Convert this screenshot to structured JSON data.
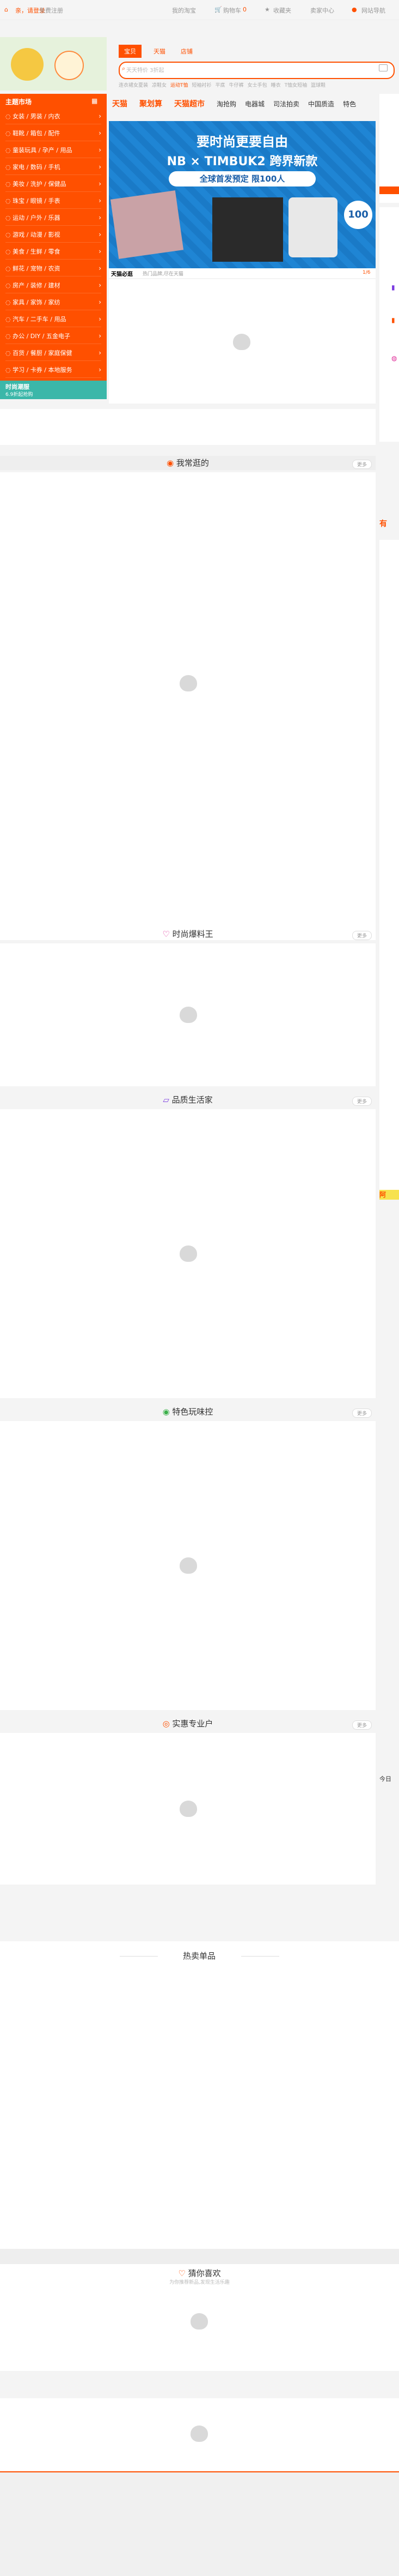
{
  "topbar": {
    "greeting": "亲，请登录",
    "register": "免费注册",
    "my_taobao": "我的淘宝",
    "cart": "购物车",
    "cart_count": "0",
    "favorites": "收藏夹",
    "seller_center": "卖家中心",
    "site_nav": "网站导航"
  },
  "search": {
    "tabs": [
      "宝贝",
      "天猫",
      "店铺"
    ],
    "placeholder": "天天特价 3折起",
    "hotwords": [
      "连衣裙女夏装",
      "凉鞋女",
      "运动T恤",
      "短袖衬衫",
      "平底",
      "牛仔裤",
      "女士手包",
      "睡衣",
      "T恤女短袖",
      "篮球鞋"
    ]
  },
  "nav": {
    "items": [
      "天猫",
      "聚划算",
      "天猫超市",
      "淘抢购",
      "电器城",
      "司法拍卖",
      "中国质造",
      "特色"
    ]
  },
  "sidebar": {
    "title": "主题市场",
    "categories": [
      "女装 / 男装 / 内衣",
      "鞋靴 / 箱包 / 配件",
      "童装玩具 / 孕产 / 用品",
      "家电 / 数码 / 手机",
      "美妆 / 洗护 / 保健品",
      "珠宝 / 眼镜 / 手表",
      "运动 / 户外 / 乐器",
      "游戏 / 动漫 / 影视",
      "美食 / 生鲜 / 零食",
      "鲜花 / 宠物 / 农资",
      "房产 / 装修 / 建材",
      "家具 / 家饰 / 家纺",
      "汽车 / 二手车 / 用品",
      "办公 / DIY / 五金电子",
      "百货 / 餐厨 / 家庭保健",
      "学习 / 卡券 / 本地服务"
    ],
    "promo_title": "时尚潮服",
    "promo_sub": "6.9折起抢购"
  },
  "banner": {
    "headline": "要时尚更要自由",
    "brand": "NB × TIMBUK2 跨界新款",
    "cta": "全球首发预定 限100人",
    "badge": "100",
    "caption_brand": "天猫必逛",
    "caption_text": "热门品牌,尽在天猫",
    "pager": "1/6"
  },
  "sections": [
    {
      "title": "我常逛的",
      "more": "更多"
    },
    {
      "title": "时尚爆料王",
      "more": "更多"
    },
    {
      "title": "品质生活家",
      "more": "更多"
    },
    {
      "title": "特色玩味控",
      "more": "更多"
    },
    {
      "title": "实惠专业户",
      "more": "更多"
    }
  ],
  "hot_items": {
    "title": "热卖单品"
  },
  "guess": {
    "title": "猜你喜欢",
    "subtitle": "为你推荐新品,发现生活乐趣"
  },
  "right_labels": {
    "tag1": "有",
    "tag2": "阿",
    "tag3": "今日"
  },
  "colors": {
    "accent": "#ff5000",
    "banner": "#1a7ac7"
  }
}
